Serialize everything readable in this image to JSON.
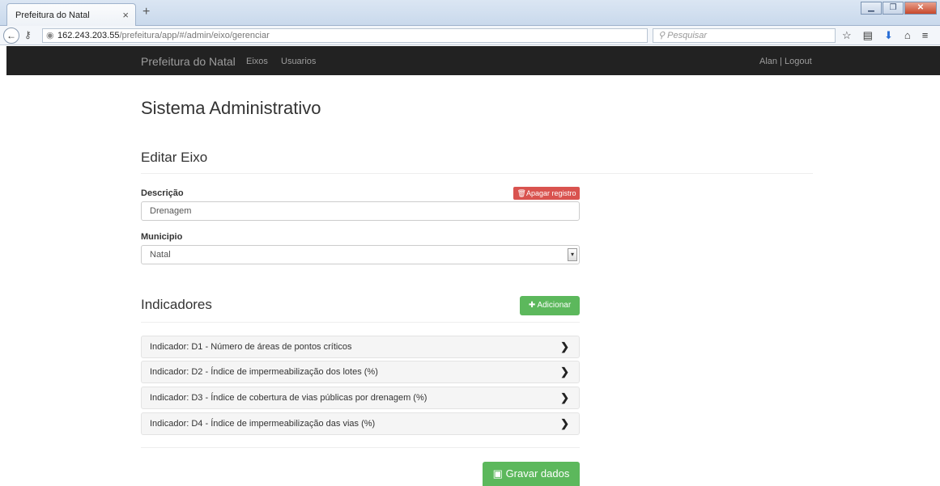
{
  "browser": {
    "tab_title": "Prefeitura do Natal",
    "tab_close": "×",
    "new_tab": "+",
    "url_host": "162.243.203.55",
    "url_path": "/prefeitura/app/#/admin/eixo/gerenciar",
    "reload": "▿ C",
    "search_placeholder": "Pesquisar"
  },
  "nav": {
    "brand": "Prefeitura do Natal",
    "links": [
      "Eixos",
      "Usuarios"
    ],
    "user": "Alan | Logout"
  },
  "page": {
    "title": "Sistema Administrativo",
    "edit_title": "Editar Eixo",
    "descricao_label": "Descrição",
    "delete_button": "Apagar registro",
    "descricao_value": "Drenagem",
    "municipio_label": "Municipio",
    "municipio_value": "Natal",
    "indicadores_title": "Indicadores",
    "add_button": "Adicionar",
    "indicators": [
      "Indicador: D1 - Número de áreas de pontos críticos",
      "Indicador: D2 - Índice de impermeabilização dos lotes (%)",
      "Indicador: D3 - Índice de cobertura de vias públicas por drenagem (%)",
      "Indicador: D4 - Índice de impermeabilização das vias (%)"
    ],
    "save_button": "Gravar dados"
  }
}
